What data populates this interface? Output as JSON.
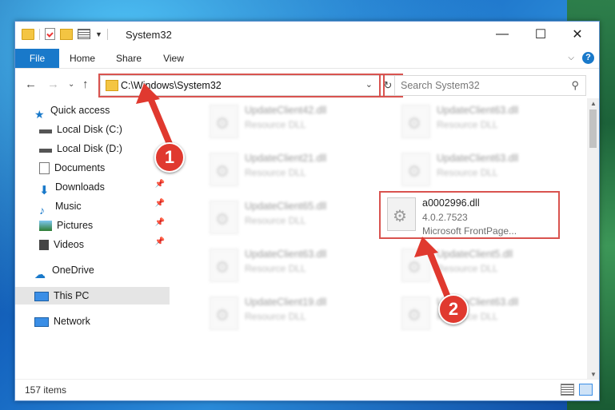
{
  "window": {
    "title": "System32"
  },
  "ribbon": {
    "tabs": [
      "File",
      "Home",
      "Share",
      "View"
    ],
    "help": "?"
  },
  "address": {
    "path": "C:\\Windows\\System32"
  },
  "search": {
    "placeholder": "Search System32"
  },
  "sidebar": {
    "items": [
      {
        "label": "Quick access"
      },
      {
        "label": "Local Disk (C:)"
      },
      {
        "label": "Local Disk (D:)"
      },
      {
        "label": "Documents"
      },
      {
        "label": "Downloads"
      },
      {
        "label": "Music"
      },
      {
        "label": "Pictures"
      },
      {
        "label": "Videos"
      },
      {
        "label": "OneDrive"
      },
      {
        "label": "This PC"
      },
      {
        "label": "Network"
      }
    ]
  },
  "files": [
    {
      "name": "UpdateClient42.dll",
      "sub": "Resource DLL"
    },
    {
      "name": "UpdateClient63.dll",
      "sub": "Resource DLL"
    },
    {
      "name": "UpdateClient21.dll",
      "sub": "Resource DLL"
    },
    {
      "name": "UpdateClient63.dll",
      "sub": "Resource DLL"
    },
    {
      "name": "UpdateClient65.dll",
      "sub": "Resource DLL"
    },
    {
      "name": "a0002996.dll",
      "sub": "4.0.2.7523",
      "sub2": "Microsoft FrontPage..."
    },
    {
      "name": "UpdateClient63.dll",
      "sub": "Resource DLL"
    },
    {
      "name": "UpdateClient5.dll",
      "sub": "Resource DLL"
    },
    {
      "name": "UpdateClient19.dll",
      "sub": "Resource DLL"
    },
    {
      "name": "UpdateClient63.dll",
      "sub": "Resource DLL"
    }
  ],
  "status": {
    "count": "157 items"
  },
  "callouts": [
    "1",
    "2"
  ],
  "colors": {
    "accent": "#1979ca",
    "highlight_box": "#d9534f",
    "callout": "#e0392f"
  }
}
